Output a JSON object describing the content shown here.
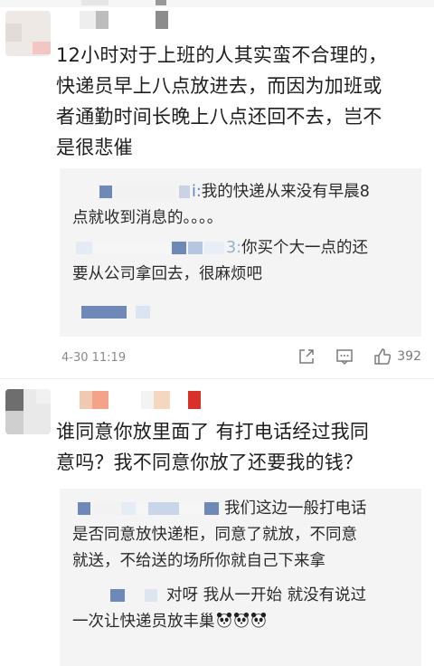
{
  "comments": [
    {
      "text": "12小时对于上班的人其实蛮不合理的，快递员早上八点放进去，而因为加班或者通勤时间长晚上八点还回不去，岂不是很悲催",
      "lines": [
        "12小时对于上班的人其实蛮不合理的，",
        "快递员早上八点放进去，而因为加班或",
        "者通勤时间长晚上八点还回不去，岂不",
        "是很悲催"
      ],
      "replies": [
        {
          "suffix": "i:",
          "lines": [
            "我的快递从来没有早晨8",
            "点就收到消息的。。。。"
          ]
        },
        {
          "suffix": "3:",
          "lines": [
            "你买个大一点的还",
            "要从公司拿回去，很麻烦吧"
          ]
        }
      ],
      "timestamp": "4-30 11:19",
      "likes": "392"
    },
    {
      "lines": [
        "谁同意你放里面了 有打电话经过我同",
        "意吗？我不同意你放了还要我的钱？"
      ],
      "replies": [
        {
          "lines": [
            "我们这边一般打电话",
            "是否同意放快递柜，同意了就放，不同意",
            "就送，不给送的场所你就自己下来拿"
          ]
        },
        {
          "lines": [
            "对呀 我从一开始 就没有说过",
            "一次让快递员放丰巢"
          ]
        }
      ]
    }
  ],
  "icons": [
    "share-icon",
    "comment-icon",
    "like-icon",
    "panda-emoji-icon"
  ],
  "colors": {
    "accent_blue": "#5b7fbf",
    "text": "#1e1e1e",
    "muted": "#8a8a8a",
    "reply_bg": "#f4f4f4"
  }
}
